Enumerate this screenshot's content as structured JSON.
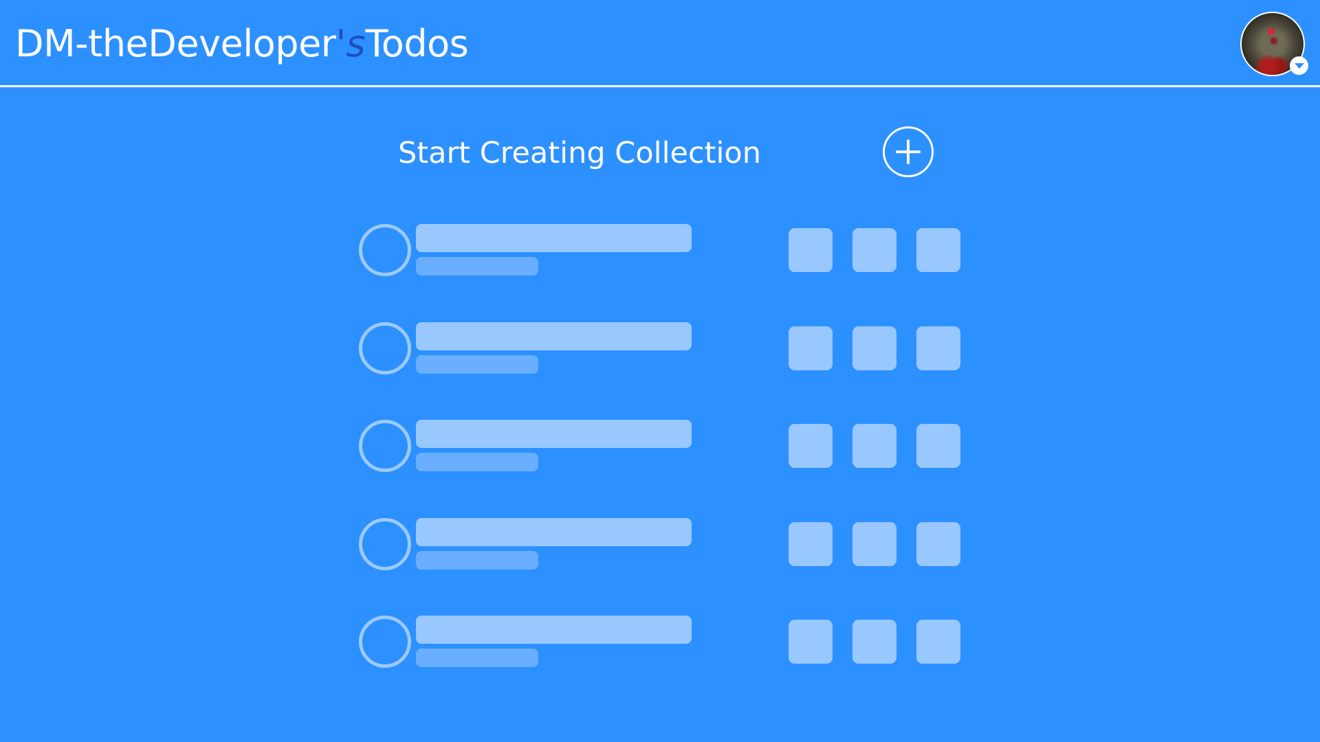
{
  "header": {
    "title_prefix": "DM-theDeveloper",
    "title_possessive": "'s",
    "title_suffix": "Todos",
    "avatar_icon": "user-avatar",
    "avatar_menu_icon": "chevron-down-icon"
  },
  "main": {
    "heading": "Start Creating Collection",
    "add_icon": "plus-circle-icon",
    "skeleton_row_count": 5
  },
  "colors": {
    "background": "#2d90ff",
    "header_divider": "#ffffff",
    "title_accent": "#1f4fbf",
    "skeleton_light": "#99c8ff",
    "skeleton_dark": "#6aaeff"
  }
}
